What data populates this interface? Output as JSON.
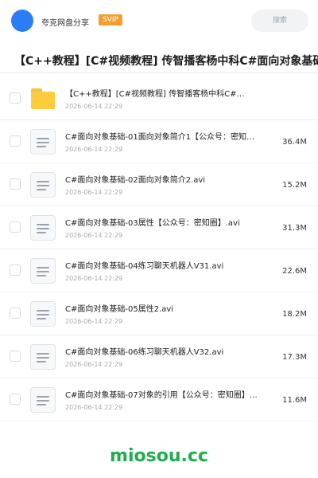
{
  "header": {
    "username": "夸克网盘分享",
    "badge": "SVIP",
    "search_placeholder": "搜索"
  },
  "title": "【C++教程】[C#视频教程] 传智播客杨中科C#面向对象基础",
  "files": [
    {
      "type": "folder",
      "icon": "folder-icon",
      "name": "【C++教程】[C#视频教程] 传智播客杨中科C#…",
      "date": "2026-06-14 22:29",
      "size": ""
    },
    {
      "type": "file",
      "icon": "document-icon",
      "name": "C#面向对象基础-01面向对象简介1【公众号：密知…",
      "date": "2026-06-14 22:29",
      "size": "36.4M"
    },
    {
      "type": "file",
      "icon": "document-icon",
      "name": "C#面向对象基础-02面向对象简介2.avi",
      "date": "2026-06-14 22:29",
      "size": "15.2M"
    },
    {
      "type": "file",
      "icon": "document-icon",
      "name": "C#面向对象基础-03属性【公众号：密知圈】.avi",
      "date": "2026-06-14 22:29",
      "size": "31.3M"
    },
    {
      "type": "file",
      "icon": "document-icon",
      "name": "C#面向对象基础-04练习聊天机器人V31.avi",
      "date": "2026-06-14 22:29",
      "size": "22.6M"
    },
    {
      "type": "file",
      "icon": "document-icon",
      "name": "C#面向对象基础-05属性2.avi",
      "date": "2026-06-14 22:29",
      "size": "18.2M"
    },
    {
      "type": "file",
      "icon": "document-icon",
      "name": "C#面向对象基础-06练习聊天机器人V32.avi",
      "date": "2026-06-14 22:29",
      "size": "17.3M"
    },
    {
      "type": "file",
      "icon": "document-icon",
      "name": "C#面向对象基础-07对象的引用【公众号：密知圈】…",
      "date": "2026-06-14 22:29",
      "size": "11.6M"
    }
  ],
  "footer": {
    "watermark": "miosou.cc"
  },
  "colors": {
    "accent": "#2b7df6",
    "badge": "#f59e2f",
    "folder": "#ffcc3e",
    "watermark": "#1fae4f"
  }
}
